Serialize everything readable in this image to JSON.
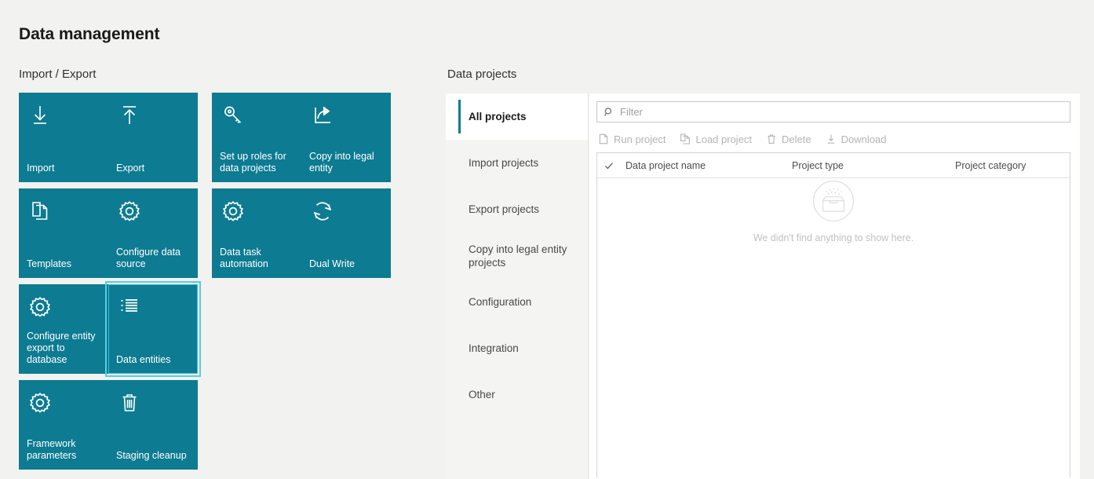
{
  "page": {
    "title": "Data management"
  },
  "import_export": {
    "heading": "Import / Export",
    "tiles": [
      {
        "label": "Import",
        "icon": "download-arrow-icon",
        "selected": false
      },
      {
        "label": "Export",
        "icon": "upload-arrow-icon",
        "selected": false
      },
      {
        "label": "Set up roles for data projects",
        "icon": "key-icon",
        "selected": false
      },
      {
        "label": "Copy into legal entity",
        "icon": "share-export-icon",
        "selected": false
      },
      {
        "label": "Templates",
        "icon": "copy-pages-icon",
        "selected": false
      },
      {
        "label": "Configure data source",
        "icon": "gear-icon",
        "selected": false
      },
      {
        "label": "Data task automation",
        "icon": "gear-icon",
        "selected": false
      },
      {
        "label": "Dual Write",
        "icon": "sync-circular-arrows-icon",
        "selected": false
      },
      {
        "label": "Configure entity export to database",
        "icon": "gear-icon",
        "selected": false
      },
      {
        "label": "Data entities",
        "icon": "bulleted-list-icon",
        "selected": true
      },
      {
        "label": "Framework parameters",
        "icon": "gear-icon",
        "selected": false
      },
      {
        "label": "Staging cleanup",
        "icon": "trash-can-icon",
        "selected": false
      }
    ]
  },
  "data_projects": {
    "heading": "Data projects",
    "nav": [
      {
        "label": "All projects",
        "selected": true
      },
      {
        "label": "Import projects",
        "selected": false
      },
      {
        "label": "Export projects",
        "selected": false
      },
      {
        "label": "Copy into legal entity projects",
        "selected": false
      },
      {
        "label": "Configuration",
        "selected": false
      },
      {
        "label": "Integration",
        "selected": false
      },
      {
        "label": "Other",
        "selected": false
      }
    ],
    "filter": {
      "placeholder": "Filter",
      "value": "",
      "icon": "search-icon"
    },
    "commands": [
      {
        "label": "Run project",
        "icon": "page-run-icon",
        "disabled": true
      },
      {
        "label": "Load project",
        "icon": "copy-pages-icon",
        "disabled": true
      },
      {
        "label": "Delete",
        "icon": "trash-can-icon",
        "disabled": true
      },
      {
        "label": "Download",
        "icon": "download-arrow-icon",
        "disabled": true
      }
    ],
    "grid": {
      "select_all_icon": "checkmark-icon",
      "columns": [
        "Data project name",
        "Project type",
        "Project category"
      ],
      "rows": [],
      "empty_message": "We didn't find anything to show here.",
      "empty_illustration": "empty-box-icon"
    }
  },
  "colors": {
    "tile_teal": "#0d7b92",
    "tile_selected_outline": "#55cbe4",
    "nav_accent": "#0d7b92",
    "page_background": "#f2f2f0",
    "panel_background": "#ffffff",
    "disabled_text": "#b6b4b2"
  }
}
